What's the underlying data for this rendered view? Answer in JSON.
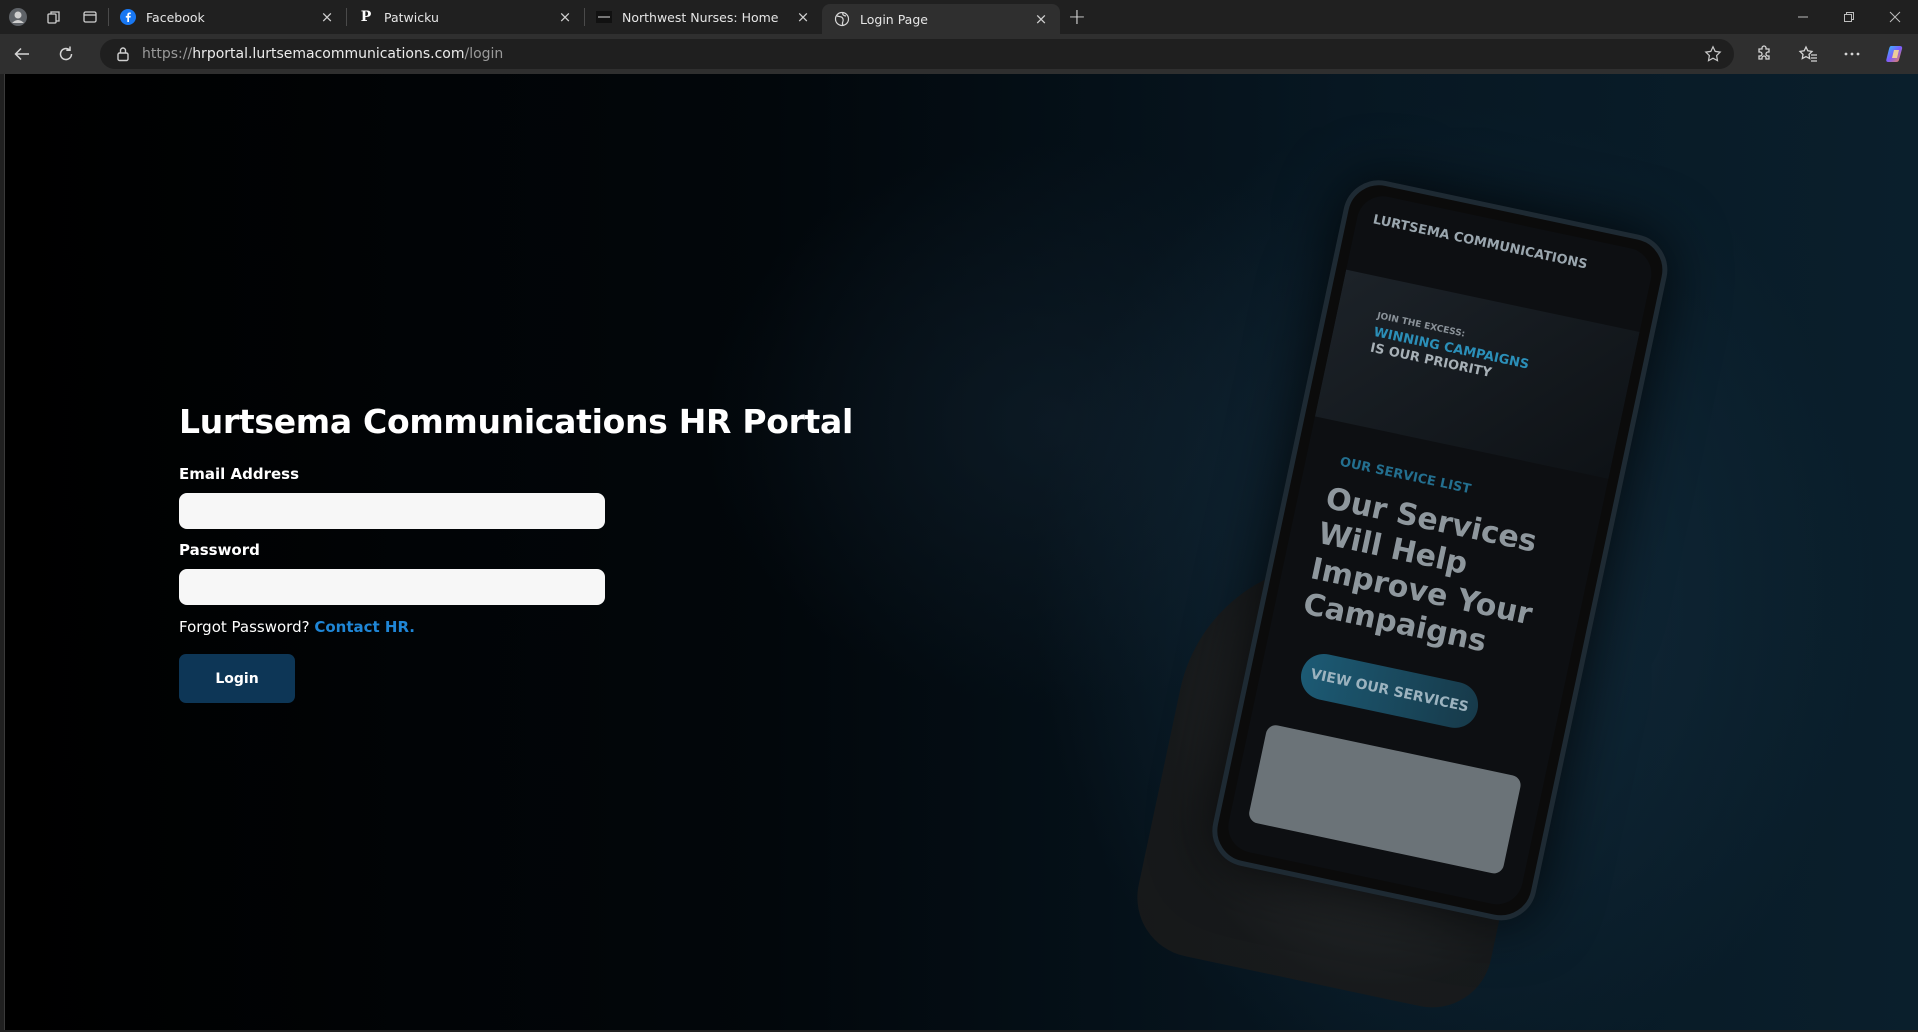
{
  "browser": {
    "tabs": [
      {
        "title": "Facebook",
        "favicon": "facebook-icon",
        "active": false
      },
      {
        "title": "Patwicku",
        "favicon": "p-letter-icon",
        "active": false
      },
      {
        "title": "Northwest Nurses: Home",
        "favicon": "nwn-icon",
        "active": false
      },
      {
        "title": "Login Page",
        "favicon": "globe-icon",
        "active": true
      }
    ],
    "url": {
      "scheme": "https://",
      "host": "hrportal.lurtsemacommunications.com",
      "path": "/login"
    }
  },
  "page": {
    "title": "Lurtsema Communications HR Portal",
    "email_label": "Email Address",
    "email_value": "",
    "password_label": "Password",
    "password_value": "",
    "forgot_text": "Forgot Password?",
    "contact_link": "Contact HR.",
    "login_button": "Login"
  },
  "background_phone": {
    "brand": "LURTSEMA COMMUNICATIONS",
    "hero_line1": "JOIN THE EXCESS:",
    "hero_line2": "WINNING CAMPAIGNS",
    "hero_line3": "IS OUR PRIORITY",
    "kicker": "OUR SERVICE LIST",
    "headline": "Our Services Will Help Improve Your Campaigns",
    "cta": "VIEW OUR SERVICES"
  },
  "colors": {
    "accent_link": "#1f86d6",
    "button_bg": "#0d3656",
    "chrome_bg": "#202020",
    "toolbar_bg": "#2f2f2f"
  }
}
